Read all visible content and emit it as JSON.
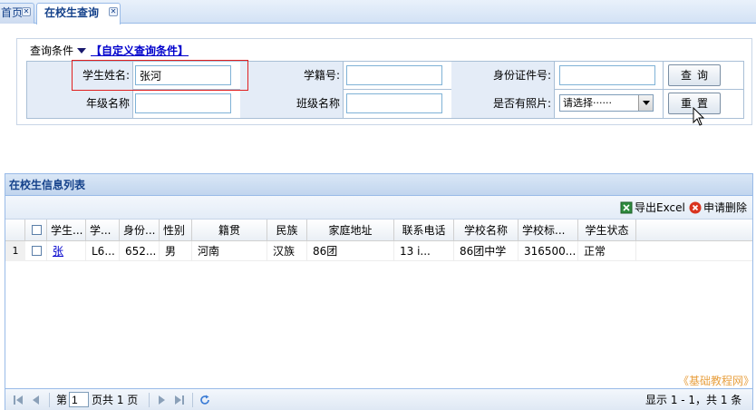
{
  "tabs": [
    {
      "label": "首页"
    },
    {
      "label": "在校生查询"
    }
  ],
  "query": {
    "header_label": "查询条件",
    "custom_link": "【自定义查询条件】",
    "fields": {
      "student_name": {
        "label": "学生姓名:",
        "value": "张河"
      },
      "student_no": {
        "label": "学籍号:",
        "value": ""
      },
      "id_no": {
        "label": "身份证件号:",
        "value": ""
      },
      "grade": {
        "label": "年级名称",
        "value": ""
      },
      "class": {
        "label": "班级名称",
        "value": ""
      },
      "has_photo": {
        "label": "是否有照片:",
        "selected": "请选择······"
      }
    },
    "search_button": "查询",
    "reset_button": "重置"
  },
  "list": {
    "title": "在校生信息列表",
    "toolbar": {
      "export": "导出Excel",
      "delete": "申请删除"
    },
    "columns": [
      "学生...",
      "学...",
      "身份...",
      "性别",
      "籍贯",
      "民族",
      "家庭地址",
      "联系电话",
      "学校名称",
      "学校标...",
      "学生状态"
    ],
    "rows": [
      {
        "num": "1",
        "cells": [
          "张",
          "L6...",
          "652...",
          "男",
          "河南",
          "汉族",
          "86团",
          "13      i...",
          "86团中学",
          "316500...",
          "正常"
        ]
      }
    ]
  },
  "watermark": "《基础教程网》",
  "pager": {
    "page_prefix": "第",
    "page_value": "1",
    "page_suffix": "页共 1 页",
    "summary": "显示 1 - 1，共 1 条"
  },
  "colors": {
    "accent": "#15428b",
    "border": "#99bbe8",
    "highlight": "#e02020",
    "link": "#0000cc"
  }
}
